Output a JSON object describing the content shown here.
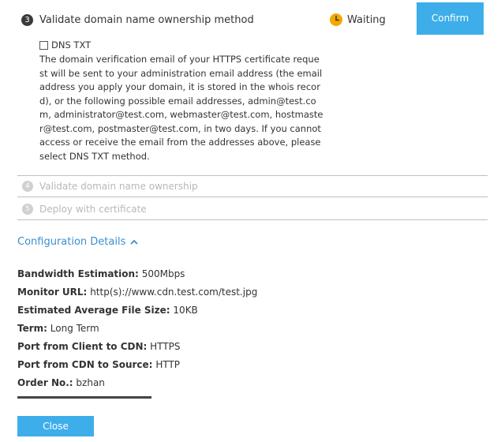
{
  "step3": {
    "number": "3",
    "title": "Validate domain name ownership method",
    "status": "Waiting",
    "confirm_label": "Confirm"
  },
  "dns_txt": {
    "label": "DNS TXT",
    "checked": false
  },
  "verification_text": "The domain verification email of your HTTPS certificate request will be sent to your administration email address (the email address you apply your domain, it is stored in the whois record), or the following possible email addresses, admin@test.com, administrator@test.com, webmaster@test.com, hostmaster@test.com, postmaster@test.com, in two days. If you cannot access or receive the email from the addresses above, please select DNS TXT method.",
  "step4": {
    "number": "4",
    "title": "Validate domain name ownership"
  },
  "step5": {
    "number": "5",
    "title": "Deploy with certificate"
  },
  "config": {
    "toggle_label": "Configuration Details",
    "details": [
      {
        "label": "Bandwidth Estimation:",
        "value": "500Mbps"
      },
      {
        "label": "Monitor URL:",
        "value": "http(s)://www.cdn.test.com/test.jpg"
      },
      {
        "label": "Estimated Average File Size:",
        "value": "10KB"
      },
      {
        "label": "Term:",
        "value": "Long Term"
      },
      {
        "label": "Port from Client to CDN:",
        "value": "HTTPS"
      },
      {
        "label": "Port from CDN to Source:",
        "value": "HTTP"
      },
      {
        "label": "Order No.:",
        "value": "bzhan"
      }
    ]
  },
  "close_label": "Close",
  "colors": {
    "accent": "#3daee9",
    "link": "#3a8fd0",
    "waiting_icon": "#f5a800",
    "disabled_text": "#b8b8b8"
  },
  "icons": {
    "step3_status": "clock-icon",
    "config_toggle": "chevron-up-icon"
  }
}
